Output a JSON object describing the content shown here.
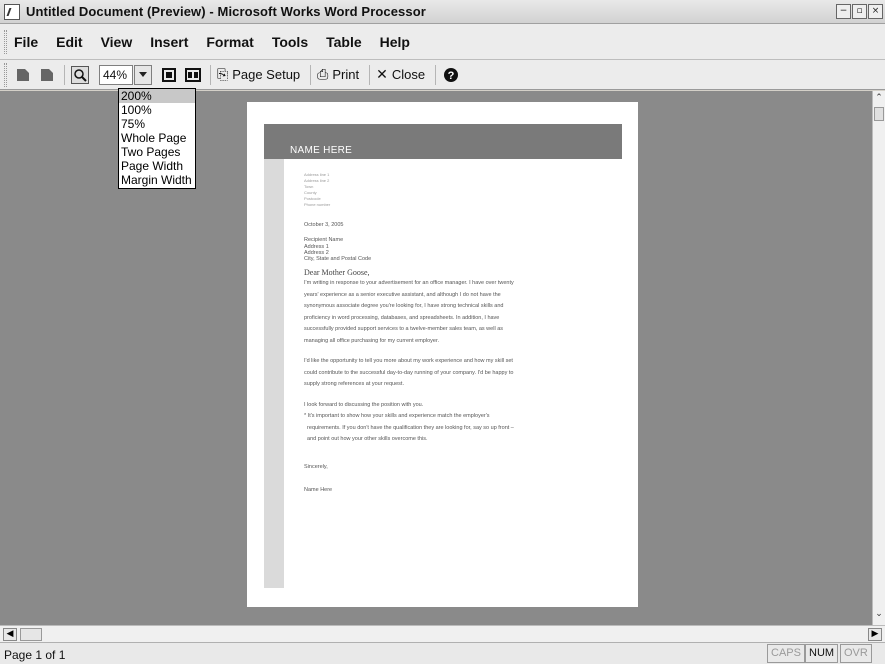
{
  "window": {
    "title": "Untitled Document (Preview) - Microsoft Works Word Processor",
    "buttons": [
      "−",
      "▫",
      "×"
    ]
  },
  "menu": [
    "File",
    "Edit",
    "View",
    "Insert",
    "Format",
    "Tools",
    "Table",
    "Help"
  ],
  "toolbar": {
    "zoom_value": "44%",
    "page_setup_label": "Page Setup",
    "print_label": "Print",
    "close_label": "Close"
  },
  "zoom_dropdown": {
    "options": [
      "200%",
      "100%",
      "75%",
      "Whole Page",
      "Two Pages",
      "Page Width",
      "Margin Width"
    ],
    "highlighted": "200%"
  },
  "document": {
    "name_header": "NAME HERE",
    "address_block": [
      "Address line 1",
      "Address line 2",
      "Town",
      "County",
      "Postcode",
      "Phone number"
    ],
    "date": "October 3, 2005",
    "recipient": [
      "Recipient Name",
      "Address 1",
      "Address 2",
      "City, State and Postal Code"
    ],
    "salutation": "Dear Mother Goose,",
    "para1": "I'm writing in response to your advertisement for an office manager. I have over twenty\nyears' experience as a senior executive assistant, and although I do not have the\nsynonymous associate degree you're looking for, I have strong technical skills and\nproficiency in word processing, databases, and spreadsheets. In addition, I have\nsuccessfully provided support services to a twelve-member sales team, as well as\nmanaging all office purchasing for my current employer.",
    "para2": "I'd like the opportunity to tell you more about my work experience and how my skill set\ncould contribute to the successful day-to-day running of your company. I'd be happy to\nsupply strong references at your request.",
    "para3": "I look forward to discussing the position with you.\n* It's important to show how your skills and experience match the employer's\n  requirements. If you don't have the qualification they are looking for, say so up front –\n  and point out how your other skills overcome this.",
    "closing": "Sincerely,",
    "signature": "Name Here"
  },
  "status": {
    "page": "Page 1 of 1",
    "caps": "CAPS",
    "num": "NUM",
    "ovr": "OVR"
  }
}
